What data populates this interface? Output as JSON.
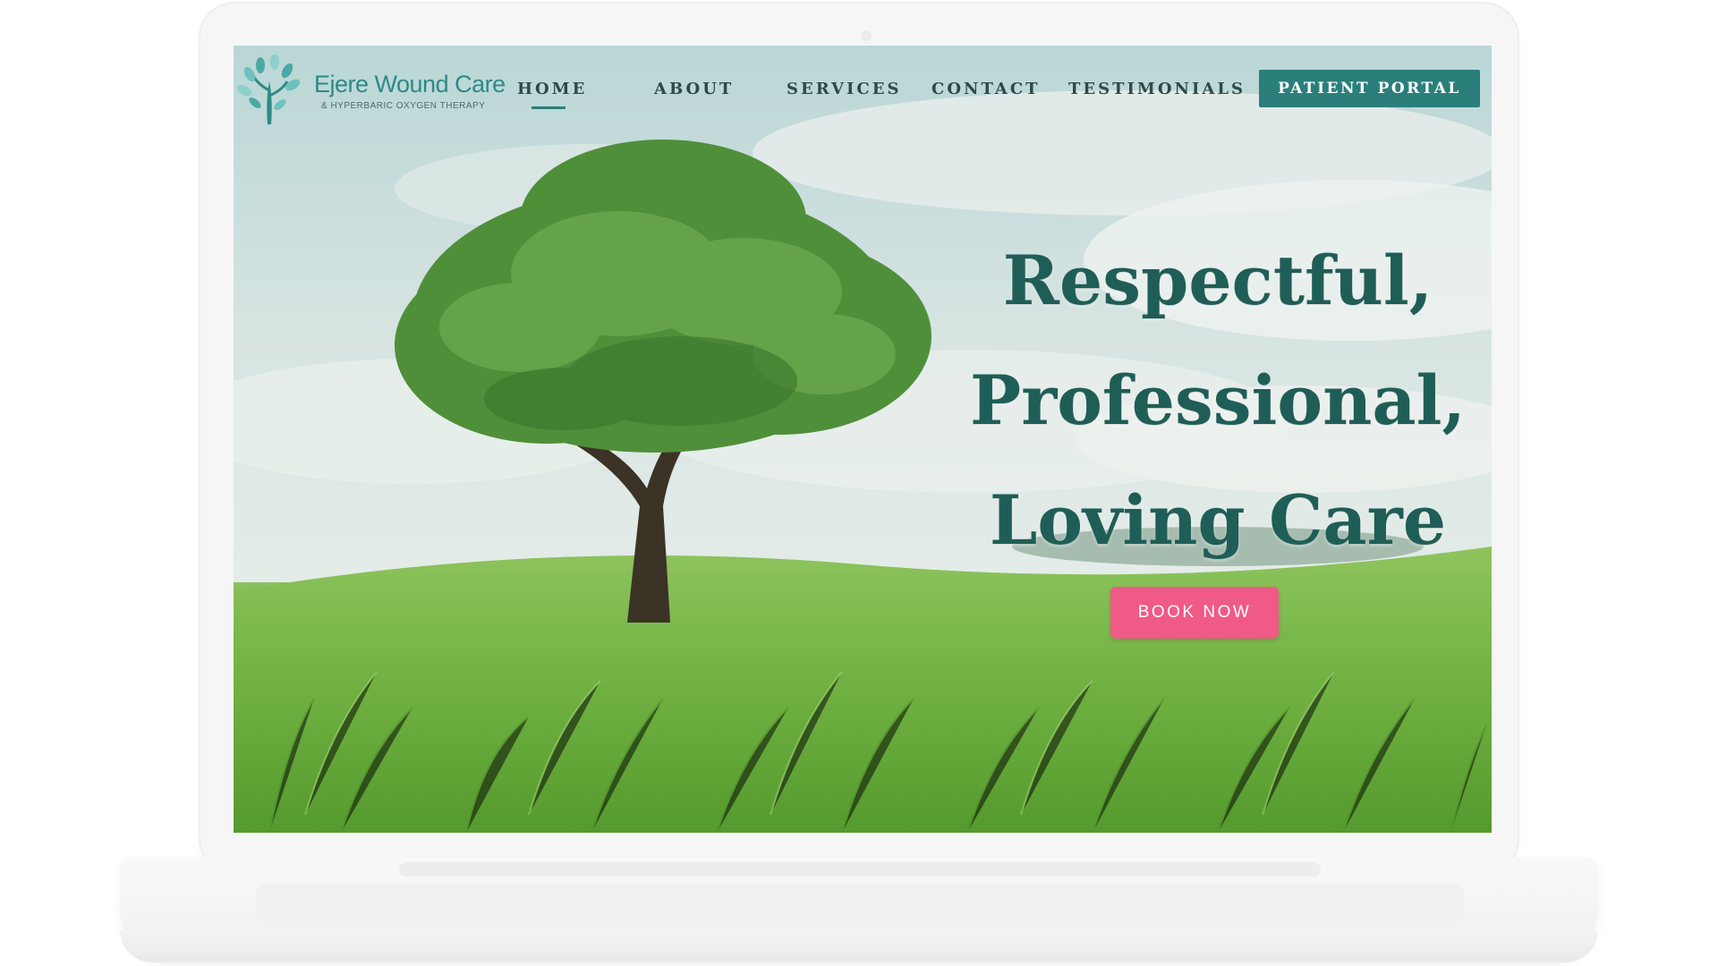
{
  "site": {
    "logo": {
      "title": "Ejere Wound Care",
      "subtitle": "& HYPERBARIC OXYGEN THERAPY"
    },
    "nav": {
      "items": [
        {
          "label": "HOME",
          "active": true
        },
        {
          "label": "ABOUT",
          "active": false
        },
        {
          "label": "SERVICES",
          "active": false
        },
        {
          "label": "CONTACT",
          "active": false
        },
        {
          "label": "TESTIMONIALS",
          "active": false
        }
      ],
      "portal_label": "PATIENT PORTAL"
    },
    "hero": {
      "headline_lines": [
        "Respectful,",
        "Professional,",
        "Loving Care"
      ],
      "cta_label": "BOOK NOW"
    }
  },
  "colors": {
    "brand_teal": "#2a7f7b",
    "headline": "#1f5e57",
    "cta_pink": "#f05a87"
  }
}
